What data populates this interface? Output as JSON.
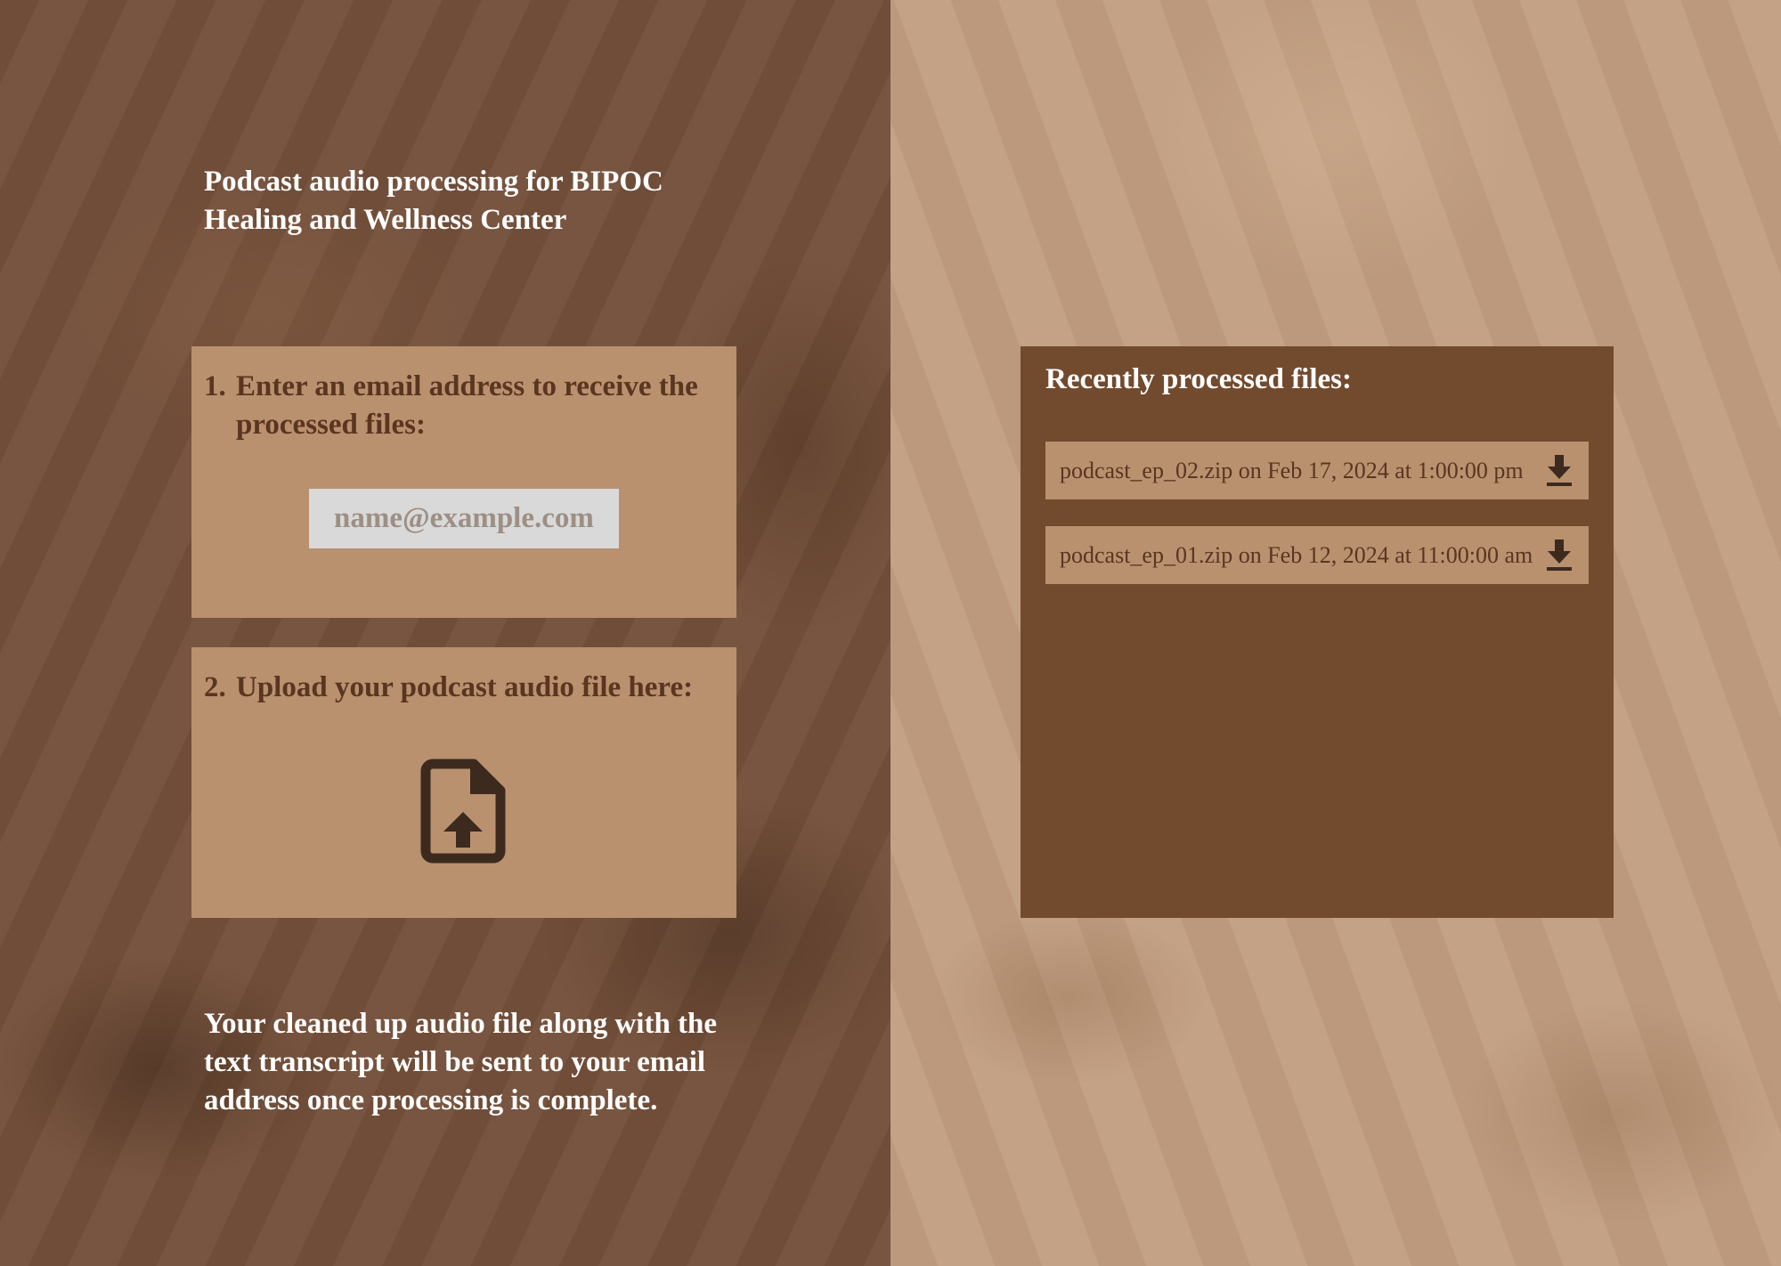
{
  "page": {
    "title": "Podcast audio processing for BIPOC Healing and Wellness Center",
    "footnote": "Your cleaned up audio file along with the text transcript will be sent to your email address once processing is complete."
  },
  "email_step": {
    "number": "1.",
    "label": "Enter an email address to receive the processed files:",
    "input_value": "",
    "input_placeholder": "name@example.com"
  },
  "upload_step": {
    "number": "2.",
    "label": "Upload your podcast audio file here:",
    "icon": "file-upload-icon"
  },
  "recent": {
    "title": "Recently processed files:",
    "files": [
      {
        "text": "podcast_ep_02.zip on Feb 17, 2024 at 1:00:00 pm",
        "icon": "download-icon"
      },
      {
        "text": "podcast_ep_01.zip on Feb 12, 2024 at 11:00:00 am",
        "icon": "download-icon"
      }
    ]
  },
  "colors": {
    "left_background": "#74503a",
    "right_background": "#c29e80",
    "panel_light": "#b9916f",
    "panel_dark": "#724a2e",
    "text_dark": "#5a3520",
    "text_light": "#ffffff",
    "input_background": "#d9d9d9",
    "icon_color": "#3d2a1f"
  }
}
